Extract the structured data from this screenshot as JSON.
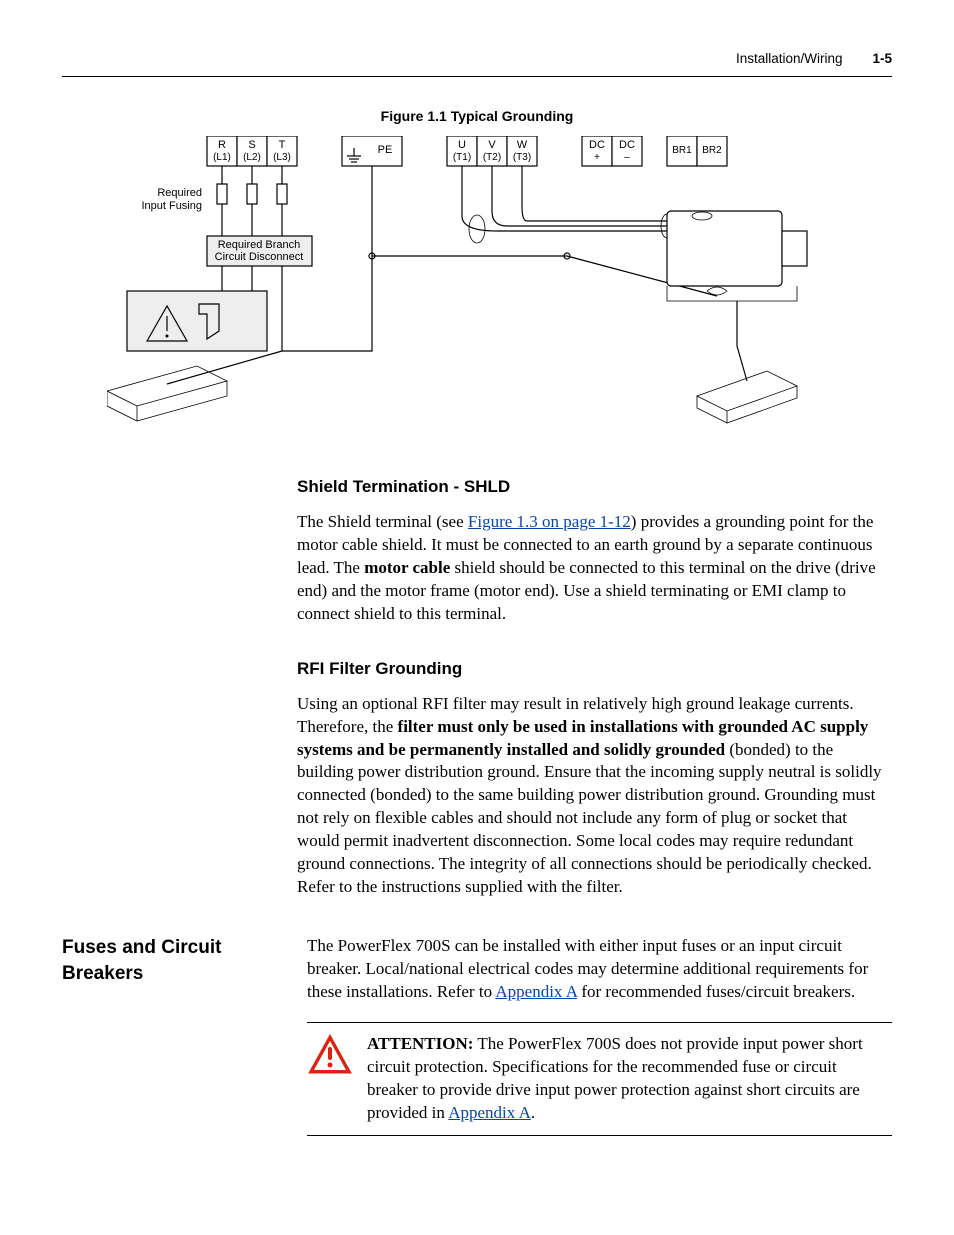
{
  "header": {
    "section": "Installation/Wiring",
    "page_number": "1-5"
  },
  "figure": {
    "caption": "Figure 1.1   Typical Grounding",
    "terminals": {
      "r": "R",
      "r_sub": "(L1)",
      "s": "S",
      "s_sub": "(L2)",
      "t": "T",
      "t_sub": "(L3)",
      "pe": "PE",
      "u": "U",
      "u_sub": "(T1)",
      "v": "V",
      "v_sub": "(T2)",
      "w": "W",
      "w_sub": "(T3)",
      "dcp": "DC",
      "dcp_sub": "+",
      "dcm": "DC",
      "dcm_sub": "–",
      "br1": "BR1",
      "br2": "BR2"
    },
    "labels": {
      "required_input_fusing_l1": "Required",
      "required_input_fusing_l2": "Input Fusing",
      "required_branch_l1": "Required Branch",
      "required_branch_l2": "Circuit Disconnect"
    }
  },
  "shld": {
    "heading": "Shield Termination - SHLD",
    "p1_a": "The Shield terminal (see ",
    "p1_link": "Figure 1.3 on page 1-12",
    "p1_b": ") provides a grounding point for the motor cable shield. It must be connected to an earth ground by a separate continuous lead. The ",
    "p1_bold": "motor cable",
    "p1_c": " shield should be connected to this terminal on the drive (drive end) and the motor frame (motor end). Use a shield terminating or EMI clamp to connect shield to this terminal."
  },
  "rfi": {
    "heading": "RFI Filter Grounding",
    "p1_a": "Using an optional RFI filter may result in relatively high ground leakage currents. Therefore, the ",
    "p1_bold": "filter must only be used in installations with grounded AC supply systems and be permanently installed and solidly grounded",
    "p1_b": " (bonded) to the building power distribution ground. Ensure that the incoming supply neutral is solidly connected (bonded) to the same building power distribution ground. Grounding must not rely on flexible cables and should not include any form of plug or socket that would permit inadvertent disconnection. Some local codes may require redundant ground connections. The integrity of all connections should be periodically checked. Refer to the instructions supplied with the filter."
  },
  "fuses": {
    "heading": "Fuses and Circuit Breakers",
    "p1_a": "The PowerFlex 700S can be installed with either input fuses or an input circuit breaker. Local/national electrical codes may determine additional requirements for these installations. Refer to ",
    "p1_link": "Appendix A",
    "p1_b": " for recommended fuses/circuit breakers.",
    "attn_label": "ATTENTION:",
    "attn_a": "  The PowerFlex 700S does not provide input power short circuit protection. Specifications for the recommended fuse or circuit breaker to provide drive input power protection against short circuits are provided in ",
    "attn_link": "Appendix A",
    "attn_b": "."
  }
}
